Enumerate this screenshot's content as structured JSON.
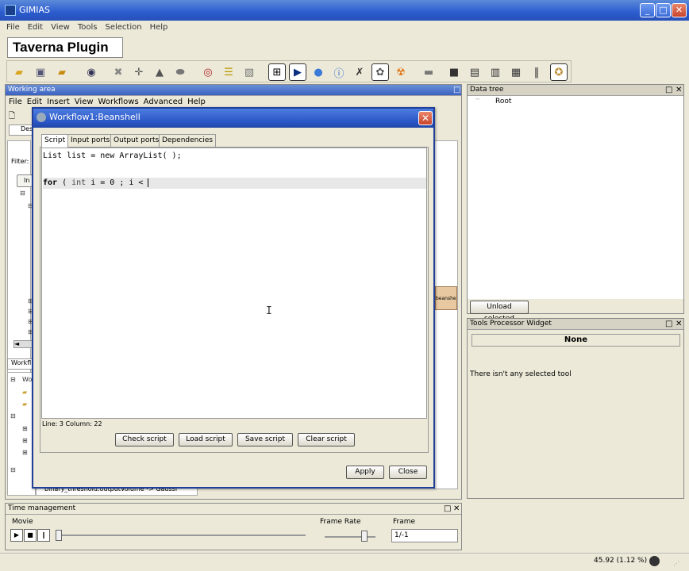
{
  "app": {
    "title": "GIMIAS",
    "minimize": "_",
    "maximize": "□",
    "close": "✕"
  },
  "main_menu": [
    "File",
    "Edit",
    "View",
    "Tools",
    "Selection",
    "Help"
  ],
  "plugin_tab": "Taverna Plugin",
  "toolbar": {
    "icons": [
      "open-folder-icon",
      "save-icon",
      "folder-icon",
      "refresh-icon",
      "tools-icon",
      "crosshair-icon",
      "lock-icon",
      "lens-icon",
      "record-icon",
      "slider-icon",
      "cube-icon",
      "tree-view-icon",
      "play-icon",
      "sphere-icon",
      "info-icon",
      "settings-cross-icon",
      "gear-icon",
      "biohazard-icon",
      "link-icon",
      "window-icon",
      "panel-icon",
      "columns-icon",
      "grid-icon",
      "pause-bars-icon",
      "taverna-icon"
    ]
  },
  "working_area": {
    "title": "Working area",
    "menu": [
      "File",
      "Edit",
      "Insert",
      "View",
      "Workflows",
      "Advanced",
      "Help"
    ],
    "filter_label": "Filter:",
    "partial_tab": "Des",
    "partial_button": "In",
    "workflow_panel_label": "Workfl",
    "tree_item_label": "Wo",
    "bottom_row_text": "binary_threshold.outputVolume -> Gaussi",
    "canvas_node_label": "beanshell"
  },
  "dialog": {
    "title": "Workflow1:Beanshell",
    "close": "✕",
    "tabs": [
      "Script",
      "Input ports",
      "Output ports",
      "Dependencies"
    ],
    "code_lines": [
      "List list = new ArrayList( );",
      "",
      "for ( int i = 0 ; i < "
    ],
    "status": "Line: 3 Column: 22",
    "script_buttons": [
      "Check script",
      "Load script",
      "Save script",
      "Clear script"
    ],
    "apply": "Apply",
    "close_button": "Close"
  },
  "data_tree": {
    "title": "Data tree",
    "root": "Root",
    "unload": "Unload selected"
  },
  "processor_widget": {
    "title": "Tools Processor Widget",
    "selected": "None",
    "message": "There isn't any selected tool"
  },
  "time_management": {
    "title": "Time management",
    "movie": "Movie",
    "frame_rate": "Frame Rate",
    "frame": "Frame",
    "frame_value": "1/-1"
  },
  "status_bar": {
    "memory": "45.92  (1.12 %)"
  }
}
